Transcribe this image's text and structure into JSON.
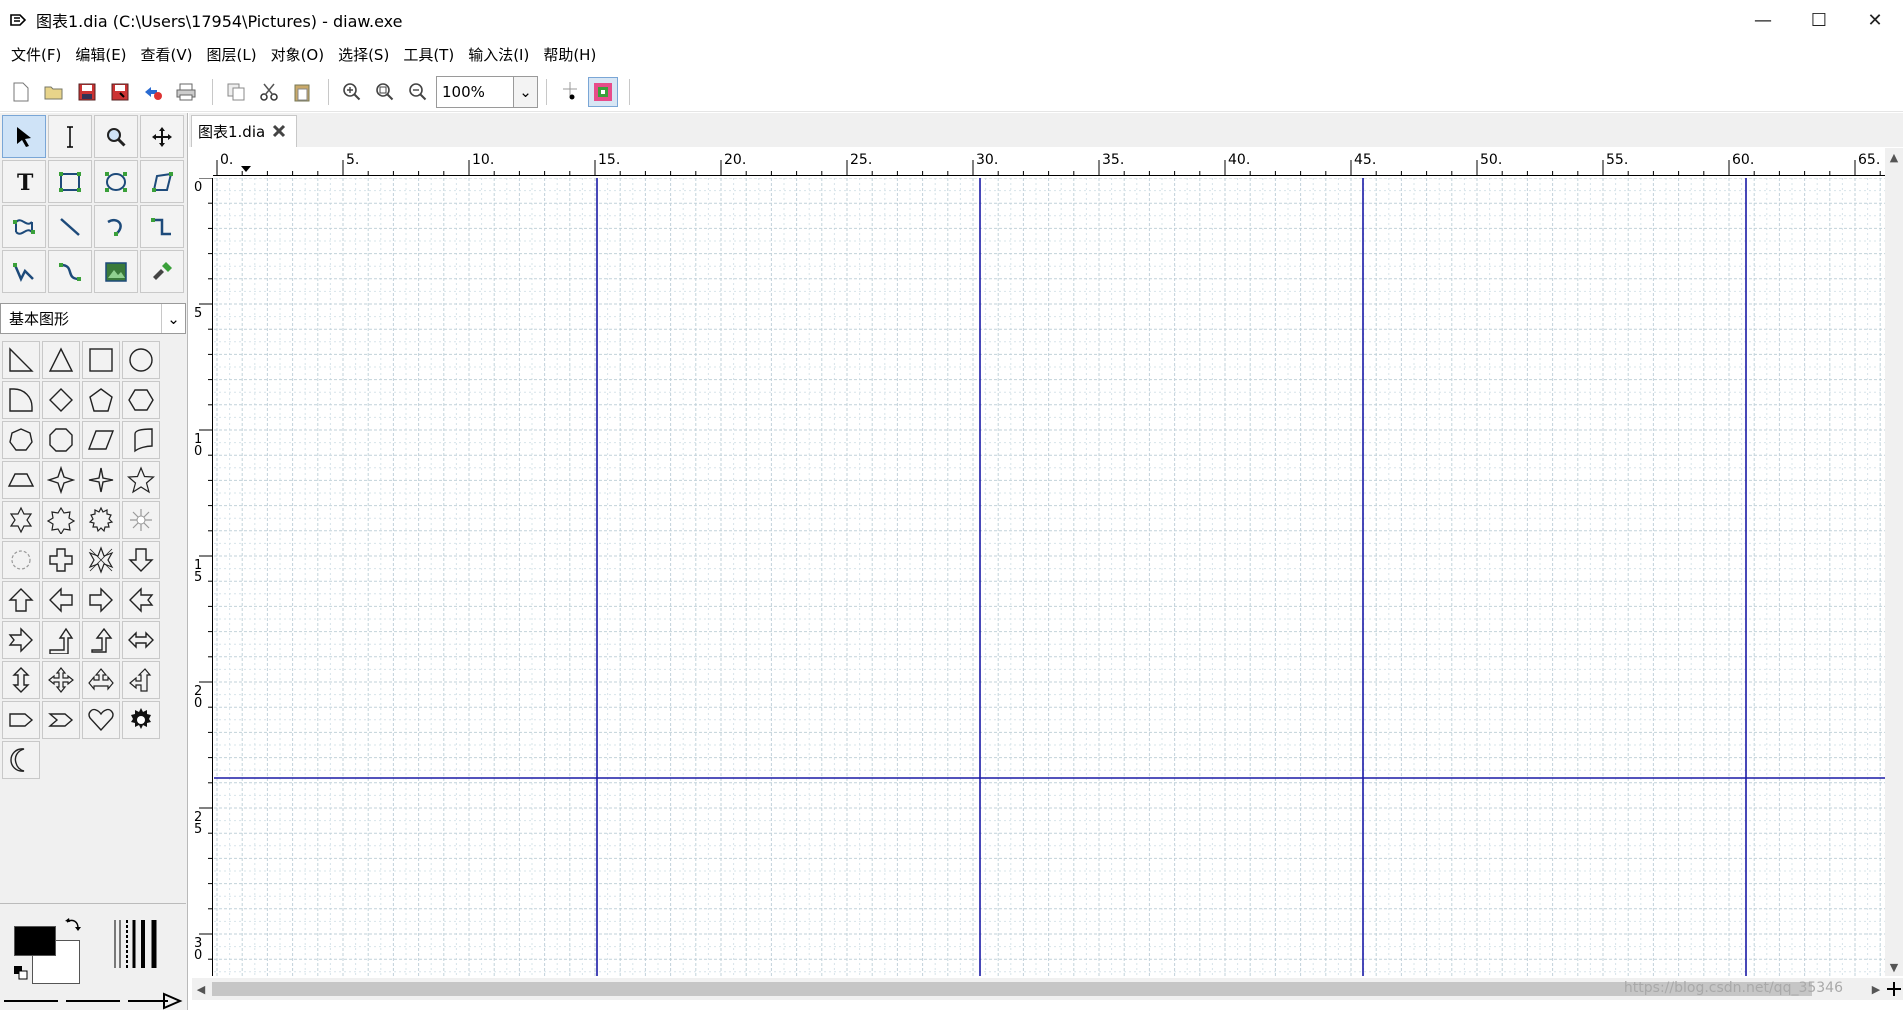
{
  "window": {
    "title": "图表1.dia (C:\\Users\\17954\\Pictures) - diaw.exe",
    "minimize": "—",
    "maximize": "☐",
    "close": "✕"
  },
  "menubar": {
    "items": [
      "文件(F)",
      "编辑(E)",
      "查看(V)",
      "图层(L)",
      "对象(O)",
      "选择(S)",
      "工具(T)",
      "输入法(I)",
      "帮助(H)"
    ]
  },
  "toolbar": {
    "zoom": "100%",
    "zoom_arrow": "⌄"
  },
  "toolbox": {
    "sheet": "基本图形",
    "sheet_arrow": "⌄"
  },
  "document": {
    "tab_label": "图表1.dia"
  },
  "rulers": {
    "h_labels": [
      "0.",
      "5.",
      "10.",
      "15.",
      "20.",
      "25.",
      "30.",
      "35.",
      "40.",
      "45.",
      "50.",
      "55.",
      "60.",
      "65."
    ],
    "v_labels": [
      "0",
      "5",
      "1\n0",
      "1\n5",
      "2\n0",
      "2\n5",
      "3\n0"
    ]
  },
  "status": {
    "watermark": "https://blog.csdn.net/qq_35346"
  },
  "colors": {
    "page_break": "#1a1aa6",
    "grid_minor": "#d7e4ea",
    "grid_major": "#c2d2da"
  }
}
